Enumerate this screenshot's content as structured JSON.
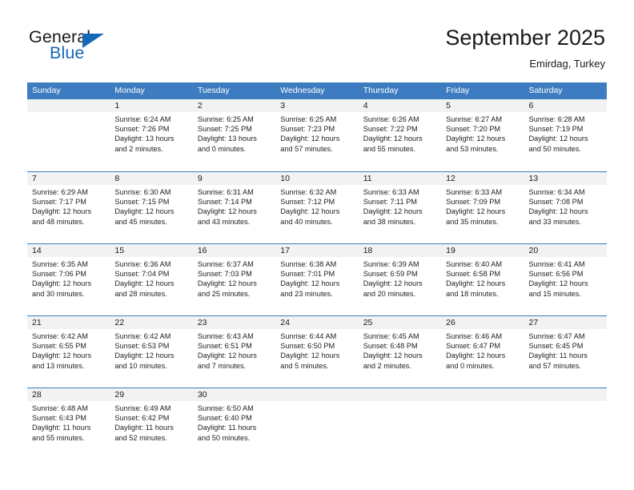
{
  "brand": {
    "name_top": "General",
    "name_bottom": "Blue",
    "accent_color": "#1668b8"
  },
  "header": {
    "title": "September 2025",
    "subtitle": "Emirdag, Turkey"
  },
  "calendar": {
    "header_bg": "#3d7cc0",
    "daynum_bg": "#f2f2f2",
    "weekday_headers": [
      "Sunday",
      "Monday",
      "Tuesday",
      "Wednesday",
      "Thursday",
      "Friday",
      "Saturday"
    ],
    "weeks": [
      [
        {
          "day": "",
          "sunrise": "",
          "sunset": "",
          "daylight_line1": "",
          "daylight_line2": ""
        },
        {
          "day": "1",
          "sunrise": "Sunrise: 6:24 AM",
          "sunset": "Sunset: 7:26 PM",
          "daylight_line1": "Daylight: 13 hours",
          "daylight_line2": "and 2 minutes."
        },
        {
          "day": "2",
          "sunrise": "Sunrise: 6:25 AM",
          "sunset": "Sunset: 7:25 PM",
          "daylight_line1": "Daylight: 13 hours",
          "daylight_line2": "and 0 minutes."
        },
        {
          "day": "3",
          "sunrise": "Sunrise: 6:25 AM",
          "sunset": "Sunset: 7:23 PM",
          "daylight_line1": "Daylight: 12 hours",
          "daylight_line2": "and 57 minutes."
        },
        {
          "day": "4",
          "sunrise": "Sunrise: 6:26 AM",
          "sunset": "Sunset: 7:22 PM",
          "daylight_line1": "Daylight: 12 hours",
          "daylight_line2": "and 55 minutes."
        },
        {
          "day": "5",
          "sunrise": "Sunrise: 6:27 AM",
          "sunset": "Sunset: 7:20 PM",
          "daylight_line1": "Daylight: 12 hours",
          "daylight_line2": "and 53 minutes."
        },
        {
          "day": "6",
          "sunrise": "Sunrise: 6:28 AM",
          "sunset": "Sunset: 7:19 PM",
          "daylight_line1": "Daylight: 12 hours",
          "daylight_line2": "and 50 minutes."
        }
      ],
      [
        {
          "day": "7",
          "sunrise": "Sunrise: 6:29 AM",
          "sunset": "Sunset: 7:17 PM",
          "daylight_line1": "Daylight: 12 hours",
          "daylight_line2": "and 48 minutes."
        },
        {
          "day": "8",
          "sunrise": "Sunrise: 6:30 AM",
          "sunset": "Sunset: 7:15 PM",
          "daylight_line1": "Daylight: 12 hours",
          "daylight_line2": "and 45 minutes."
        },
        {
          "day": "9",
          "sunrise": "Sunrise: 6:31 AM",
          "sunset": "Sunset: 7:14 PM",
          "daylight_line1": "Daylight: 12 hours",
          "daylight_line2": "and 43 minutes."
        },
        {
          "day": "10",
          "sunrise": "Sunrise: 6:32 AM",
          "sunset": "Sunset: 7:12 PM",
          "daylight_line1": "Daylight: 12 hours",
          "daylight_line2": "and 40 minutes."
        },
        {
          "day": "11",
          "sunrise": "Sunrise: 6:33 AM",
          "sunset": "Sunset: 7:11 PM",
          "daylight_line1": "Daylight: 12 hours",
          "daylight_line2": "and 38 minutes."
        },
        {
          "day": "12",
          "sunrise": "Sunrise: 6:33 AM",
          "sunset": "Sunset: 7:09 PM",
          "daylight_line1": "Daylight: 12 hours",
          "daylight_line2": "and 35 minutes."
        },
        {
          "day": "13",
          "sunrise": "Sunrise: 6:34 AM",
          "sunset": "Sunset: 7:08 PM",
          "daylight_line1": "Daylight: 12 hours",
          "daylight_line2": "and 33 minutes."
        }
      ],
      [
        {
          "day": "14",
          "sunrise": "Sunrise: 6:35 AM",
          "sunset": "Sunset: 7:06 PM",
          "daylight_line1": "Daylight: 12 hours",
          "daylight_line2": "and 30 minutes."
        },
        {
          "day": "15",
          "sunrise": "Sunrise: 6:36 AM",
          "sunset": "Sunset: 7:04 PM",
          "daylight_line1": "Daylight: 12 hours",
          "daylight_line2": "and 28 minutes."
        },
        {
          "day": "16",
          "sunrise": "Sunrise: 6:37 AM",
          "sunset": "Sunset: 7:03 PM",
          "daylight_line1": "Daylight: 12 hours",
          "daylight_line2": "and 25 minutes."
        },
        {
          "day": "17",
          "sunrise": "Sunrise: 6:38 AM",
          "sunset": "Sunset: 7:01 PM",
          "daylight_line1": "Daylight: 12 hours",
          "daylight_line2": "and 23 minutes."
        },
        {
          "day": "18",
          "sunrise": "Sunrise: 6:39 AM",
          "sunset": "Sunset: 6:59 PM",
          "daylight_line1": "Daylight: 12 hours",
          "daylight_line2": "and 20 minutes."
        },
        {
          "day": "19",
          "sunrise": "Sunrise: 6:40 AM",
          "sunset": "Sunset: 6:58 PM",
          "daylight_line1": "Daylight: 12 hours",
          "daylight_line2": "and 18 minutes."
        },
        {
          "day": "20",
          "sunrise": "Sunrise: 6:41 AM",
          "sunset": "Sunset: 6:56 PM",
          "daylight_line1": "Daylight: 12 hours",
          "daylight_line2": "and 15 minutes."
        }
      ],
      [
        {
          "day": "21",
          "sunrise": "Sunrise: 6:42 AM",
          "sunset": "Sunset: 6:55 PM",
          "daylight_line1": "Daylight: 12 hours",
          "daylight_line2": "and 13 minutes."
        },
        {
          "day": "22",
          "sunrise": "Sunrise: 6:42 AM",
          "sunset": "Sunset: 6:53 PM",
          "daylight_line1": "Daylight: 12 hours",
          "daylight_line2": "and 10 minutes."
        },
        {
          "day": "23",
          "sunrise": "Sunrise: 6:43 AM",
          "sunset": "Sunset: 6:51 PM",
          "daylight_line1": "Daylight: 12 hours",
          "daylight_line2": "and 7 minutes."
        },
        {
          "day": "24",
          "sunrise": "Sunrise: 6:44 AM",
          "sunset": "Sunset: 6:50 PM",
          "daylight_line1": "Daylight: 12 hours",
          "daylight_line2": "and 5 minutes."
        },
        {
          "day": "25",
          "sunrise": "Sunrise: 6:45 AM",
          "sunset": "Sunset: 6:48 PM",
          "daylight_line1": "Daylight: 12 hours",
          "daylight_line2": "and 2 minutes."
        },
        {
          "day": "26",
          "sunrise": "Sunrise: 6:46 AM",
          "sunset": "Sunset: 6:47 PM",
          "daylight_line1": "Daylight: 12 hours",
          "daylight_line2": "and 0 minutes."
        },
        {
          "day": "27",
          "sunrise": "Sunrise: 6:47 AM",
          "sunset": "Sunset: 6:45 PM",
          "daylight_line1": "Daylight: 11 hours",
          "daylight_line2": "and 57 minutes."
        }
      ],
      [
        {
          "day": "28",
          "sunrise": "Sunrise: 6:48 AM",
          "sunset": "Sunset: 6:43 PM",
          "daylight_line1": "Daylight: 11 hours",
          "daylight_line2": "and 55 minutes."
        },
        {
          "day": "29",
          "sunrise": "Sunrise: 6:49 AM",
          "sunset": "Sunset: 6:42 PM",
          "daylight_line1": "Daylight: 11 hours",
          "daylight_line2": "and 52 minutes."
        },
        {
          "day": "30",
          "sunrise": "Sunrise: 6:50 AM",
          "sunset": "Sunset: 6:40 PM",
          "daylight_line1": "Daylight: 11 hours",
          "daylight_line2": "and 50 minutes."
        },
        {
          "day": "",
          "sunrise": "",
          "sunset": "",
          "daylight_line1": "",
          "daylight_line2": ""
        },
        {
          "day": "",
          "sunrise": "",
          "sunset": "",
          "daylight_line1": "",
          "daylight_line2": ""
        },
        {
          "day": "",
          "sunrise": "",
          "sunset": "",
          "daylight_line1": "",
          "daylight_line2": ""
        },
        {
          "day": "",
          "sunrise": "",
          "sunset": "",
          "daylight_line1": "",
          "daylight_line2": ""
        }
      ]
    ]
  }
}
